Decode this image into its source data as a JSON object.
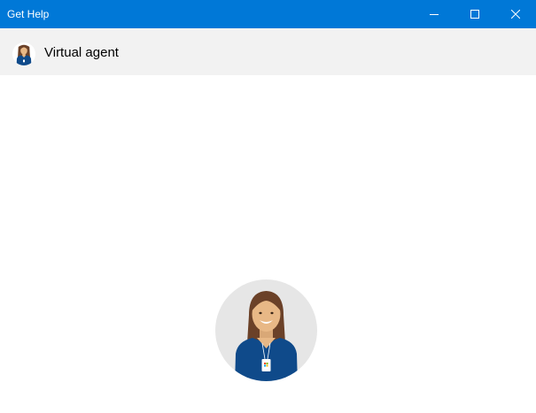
{
  "window": {
    "title": "Get Help",
    "controls": {
      "minimize_icon": "minimize-icon",
      "maximize_icon": "maximize-icon",
      "close_icon": "close-icon"
    }
  },
  "header": {
    "title": "Virtual agent",
    "avatar_icon": "virtual-agent-avatar-icon"
  },
  "main": {
    "avatar_icon": "virtual-agent-avatar-icon"
  },
  "colors": {
    "titlebar": "#0078d7",
    "header_background": "#f2f2f2",
    "avatar_circle": "#e6e6e6",
    "shirt": "#0f4a8a",
    "hair": "#6b4128",
    "skin": "#e8b886"
  }
}
